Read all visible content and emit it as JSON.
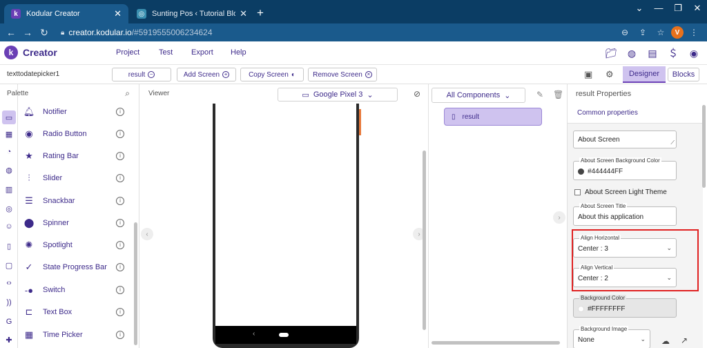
{
  "browser": {
    "tabs": [
      {
        "title": "Kodular Creator",
        "favicon": "k"
      },
      {
        "title": "Sunting Pos ‹ Tutorial Blok Progra",
        "favicon": "s"
      }
    ],
    "window_controls": [
      "⌄",
      "—",
      "❐",
      "✕"
    ],
    "url_host": "creator.kodular.io",
    "url_path": "/#5919555006234624",
    "profile_initial": "V"
  },
  "app": {
    "brand": "Creator",
    "menu": [
      "Project",
      "Test",
      "Export",
      "Help"
    ]
  },
  "toolbar": {
    "component_name": "texttodatepicker1",
    "screen_select": "result",
    "add_screen": "Add Screen",
    "copy_screen": "Copy Screen",
    "remove_screen": "Remove Screen",
    "designer": "Designer",
    "blocks": "Blocks"
  },
  "palette": {
    "title": "Palette",
    "items": [
      {
        "label": "Notifier",
        "icon": "bell-icon"
      },
      {
        "label": "Radio Button",
        "icon": "radio-icon"
      },
      {
        "label": "Rating Bar",
        "icon": "star-icon"
      },
      {
        "label": "Slider",
        "icon": "slider-icon"
      },
      {
        "label": "Snackbar",
        "icon": "snackbar-icon"
      },
      {
        "label": "Spinner",
        "icon": "spinner-icon"
      },
      {
        "label": "Spotlight",
        "icon": "spotlight-icon"
      },
      {
        "label": "State Progress Bar",
        "icon": "progress-icon"
      },
      {
        "label": "Switch",
        "icon": "switch-icon"
      },
      {
        "label": "Text Box",
        "icon": "textbox-icon"
      },
      {
        "label": "Time Picker",
        "icon": "calendar-icon"
      }
    ]
  },
  "viewer": {
    "title": "Viewer",
    "device": "Google Pixel 3"
  },
  "tree": {
    "filter": "All Components",
    "root": "result"
  },
  "properties": {
    "title": "result Properties",
    "common": "Common properties",
    "about_screen": "About Screen",
    "bg_color_label": "About Screen Background Color",
    "bg_color_value": "#444444FF",
    "light_theme": "About Screen Light Theme",
    "title_label": "About Screen Title",
    "title_value": "About this application",
    "align_h_label": "Align Horizontal",
    "align_h_value": "Center : 3",
    "align_v_label": "Align Vertical",
    "align_v_value": "Center : 2",
    "background_color_label": "Background Color",
    "background_color_value": "#FFFFFFFF",
    "background_image_label": "Background Image",
    "background_image_value": "None"
  },
  "colors": {
    "accent": "#6a3fb5",
    "highlight": "#e02020",
    "chrome": "#0b3d64"
  }
}
